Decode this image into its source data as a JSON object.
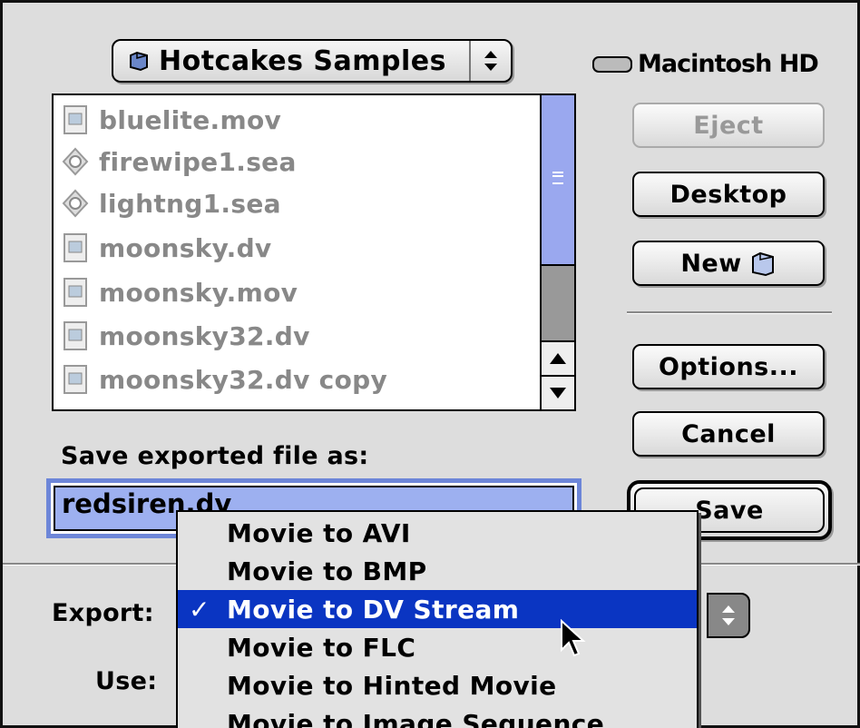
{
  "folder_popup": {
    "label": "Hotcakes Samples",
    "icon": "folder-icon"
  },
  "disk": {
    "label": "Macintosh HD",
    "icon": "hard-disk-icon"
  },
  "files": [
    {
      "name": "bluelite.mov",
      "icon": "movie-document-icon"
    },
    {
      "name": "firewipe1.sea",
      "icon": "archive-document-icon"
    },
    {
      "name": "lightng1.sea",
      "icon": "archive-document-icon"
    },
    {
      "name": "moonsky.dv",
      "icon": "movie-document-icon"
    },
    {
      "name": "moonsky.mov",
      "icon": "movie-document-icon"
    },
    {
      "name": "moonsky32.dv",
      "icon": "movie-document-icon"
    },
    {
      "name": "moonsky32.dv copy",
      "icon": "movie-document-icon"
    }
  ],
  "buttons": {
    "eject": "Eject",
    "desktop": "Desktop",
    "new": "New",
    "options": "Options...",
    "cancel": "Cancel",
    "save": "Save"
  },
  "save_label": "Save exported file as:",
  "filename": "redsiren.dv",
  "export_label": "Export:",
  "use_label": "Use:",
  "export_menu": {
    "items": [
      "Movie to AVI",
      "Movie to BMP",
      "Movie to DV Stream",
      "Movie to FLC",
      "Movie to Hinted Movie",
      "Movie to Image Sequence"
    ],
    "selected": "Movie to DV Stream",
    "checkmark": "✓"
  }
}
